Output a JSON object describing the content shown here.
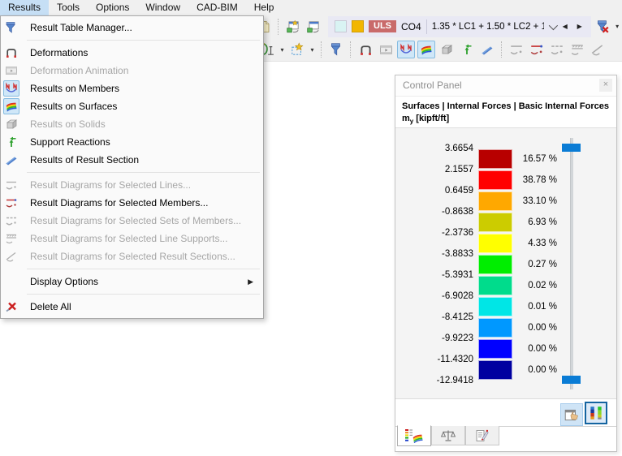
{
  "menubar": {
    "items": [
      {
        "label": "Results",
        "active": true
      },
      {
        "label": "Tools",
        "active": false
      },
      {
        "label": "Options",
        "active": false
      },
      {
        "label": "Window",
        "active": false
      },
      {
        "label": "CAD-BIM",
        "active": false
      },
      {
        "label": "Help",
        "active": false
      }
    ]
  },
  "results_menu": {
    "items": [
      {
        "label": "Result Table Manager...",
        "icon": "filter-table",
        "enabled": true
      },
      {
        "divider": true
      },
      {
        "label": "Deformations",
        "icon": "deformations",
        "enabled": true
      },
      {
        "label": "Deformation Animation",
        "icon": "animation",
        "enabled": false
      },
      {
        "label": "Results on Members",
        "icon": "members",
        "enabled": true,
        "active_icon": true
      },
      {
        "label": "Results on Surfaces",
        "icon": "surfaces",
        "enabled": true,
        "active_icon": true
      },
      {
        "label": "Results on Solids",
        "icon": "solids",
        "enabled": false
      },
      {
        "label": "Support Reactions",
        "icon": "support",
        "enabled": true
      },
      {
        "label": "Results of Result Section",
        "icon": "section",
        "enabled": true
      },
      {
        "divider": true
      },
      {
        "label": "Result Diagrams for Selected Lines...",
        "icon": "diagram-lines",
        "enabled": false
      },
      {
        "label": "Result Diagrams for Selected Members...",
        "icon": "diagram-members",
        "enabled": true
      },
      {
        "label": "Result Diagrams for Selected Sets of Members...",
        "icon": "diagram-sets",
        "enabled": false
      },
      {
        "label": "Result Diagrams for Selected Line Supports...",
        "icon": "diagram-supports",
        "enabled": false
      },
      {
        "label": "Result Diagrams for Selected Result Sections...",
        "icon": "diagram-sections",
        "enabled": false
      },
      {
        "divider": true
      },
      {
        "label": "Display Options",
        "icon": null,
        "enabled": true,
        "submenu": true
      },
      {
        "divider": true
      },
      {
        "label": "Delete All",
        "icon": "delete",
        "enabled": true
      }
    ]
  },
  "toolbar": {
    "uls_badge": "ULS",
    "combo_label": "CO4",
    "combo_value": "1.35 * LC1 + 1.50 * LC2 + 1...",
    "group_background": "#e9e9f4",
    "swatch_colors": [
      "#d9f3f3",
      "#f2b600"
    ]
  },
  "control_panel": {
    "title": "Control Panel",
    "breadcrumb": "Surfaces | Internal Forces | Basic Internal Forces",
    "quantity_main": "m",
    "quantity_sub": "y",
    "quantity_unit": " [kipft/ft]",
    "accent_blue": "#0a7cd5",
    "scale_values": [
      "3.6654",
      "2.1557",
      "0.6459",
      "-0.8638",
      "-2.3736",
      "-3.8833",
      "-5.3931",
      "-6.9028",
      "-8.4125",
      "-9.9223",
      "-11.4320",
      "-12.9418"
    ],
    "bands": [
      {
        "color": "#b80000",
        "percent": "16.57 %"
      },
      {
        "color": "#ff0000",
        "percent": "38.78 %"
      },
      {
        "color": "#ffa800",
        "percent": "33.10 %"
      },
      {
        "color": "#cccc00",
        "percent": "6.93 %"
      },
      {
        "color": "#ffff00",
        "percent": "4.33 %"
      },
      {
        "color": "#00ee00",
        "percent": "0.27 %"
      },
      {
        "color": "#00dc8c",
        "percent": "0.02 %"
      },
      {
        "color": "#00e6e6",
        "percent": "0.01 %"
      },
      {
        "color": "#0098ff",
        "percent": "0.00 %"
      },
      {
        "color": "#0000ff",
        "percent": "0.00 %"
      },
      {
        "color": "#0000a0",
        "percent": "0.00 %"
      }
    ]
  }
}
